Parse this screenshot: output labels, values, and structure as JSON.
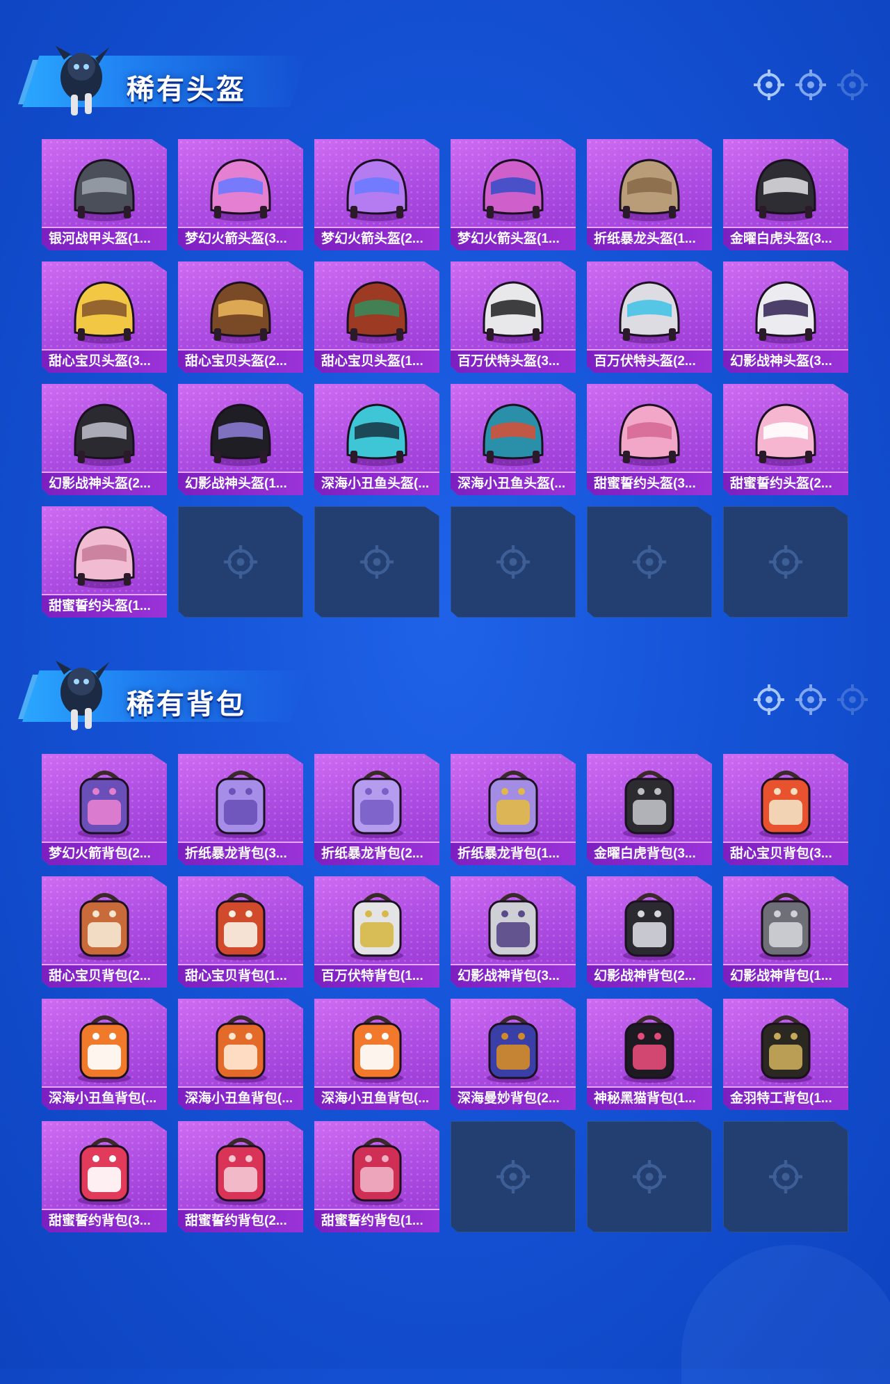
{
  "helmets": {
    "title": "稀有头盔",
    "items": [
      {
        "label": "银河战甲头盔(1...",
        "art": "helmet",
        "c1": "#4a4f5a",
        "c2": "#9aa0aa"
      },
      {
        "label": "梦幻火箭头盔(3...",
        "art": "helmet",
        "c1": "#e57fd2",
        "c2": "#6a7bff"
      },
      {
        "label": "梦幻火箭头盔(2...",
        "art": "helmet",
        "c1": "#b47cf0",
        "c2": "#6a7bff"
      },
      {
        "label": "梦幻火箭头盔(1...",
        "art": "helmet",
        "c1": "#cf5fcb",
        "c2": "#3a4fc8"
      },
      {
        "label": "折纸暴龙头盔(1...",
        "art": "helmet",
        "c1": "#b89d78",
        "c2": "#8a6b4a"
      },
      {
        "label": "金曜白虎头盔(3...",
        "art": "helmet",
        "c1": "#2d2d33",
        "c2": "#d9d9dd"
      },
      {
        "label": "甜心宝贝头盔(3...",
        "art": "helmet",
        "c1": "#f2c744",
        "c2": "#8a5a2e"
      },
      {
        "label": "甜心宝贝头盔(2...",
        "art": "helmet",
        "c1": "#7a4a26",
        "c2": "#e8b25a"
      },
      {
        "label": "甜心宝贝头盔(1...",
        "art": "helmet",
        "c1": "#9c3a24",
        "c2": "#3a8a5a"
      },
      {
        "label": "百万伏特头盔(3...",
        "art": "helmet",
        "c1": "#e8e8ea",
        "c2": "#2b2b2f"
      },
      {
        "label": "百万伏特头盔(2...",
        "art": "helmet",
        "c1": "#dcdce2",
        "c2": "#47c3e8"
      },
      {
        "label": "幻影战神头盔(3...",
        "art": "helmet",
        "c1": "#ececf0",
        "c2": "#3b2d5c"
      },
      {
        "label": "幻影战神头盔(2...",
        "art": "helmet",
        "c1": "#2a2a30",
        "c2": "#b9b9c6"
      },
      {
        "label": "幻影战神头盔(1...",
        "art": "helmet",
        "c1": "#1e1e24",
        "c2": "#8a7ad0"
      },
      {
        "label": "深海小丑鱼头盔(...",
        "art": "helmet",
        "c1": "#3ec6d6",
        "c2": "#1a3a4a"
      },
      {
        "label": "深海小丑鱼头盔(...",
        "art": "helmet",
        "c1": "#2a8fa8",
        "c2": "#d0523a"
      },
      {
        "label": "甜蜜誓约头盔(3...",
        "art": "helmet",
        "c1": "#f2a7c8",
        "c2": "#d56a96"
      },
      {
        "label": "甜蜜誓约头盔(2...",
        "art": "helmet",
        "c1": "#f6b6d0",
        "c2": "#ffffff"
      },
      {
        "label": "甜蜜誓约头盔(1...",
        "art": "helmet",
        "c1": "#f1bcd2",
        "c2": "#c77c9a"
      }
    ],
    "empty_slots": 5
  },
  "backpacks": {
    "title": "稀有背包",
    "items": [
      {
        "label": "梦幻火箭背包(2...",
        "art": "pack",
        "c1": "#6a4fb8",
        "c2": "#e47fd0"
      },
      {
        "label": "折纸暴龙背包(3...",
        "art": "pack",
        "c1": "#a58de8",
        "c2": "#6a52b8"
      },
      {
        "label": "折纸暴龙背包(2...",
        "art": "pack",
        "c1": "#b59cef",
        "c2": "#7b5fc9"
      },
      {
        "label": "折纸暴龙背包(1...",
        "art": "pack",
        "c1": "#a38ce3",
        "c2": "#e1b84a"
      },
      {
        "label": "金曜白虎背包(3...",
        "art": "pack",
        "c1": "#2b2b30",
        "c2": "#bdbdc4"
      },
      {
        "label": "甜心宝贝背包(3...",
        "art": "pack",
        "c1": "#e8522e",
        "c2": "#f2e0c0"
      },
      {
        "label": "甜心宝贝背包(2...",
        "art": "pack",
        "c1": "#c96a3a",
        "c2": "#f5e6cf"
      },
      {
        "label": "甜心宝贝背包(1...",
        "art": "pack",
        "c1": "#d24a2c",
        "c2": "#f8efe3"
      },
      {
        "label": "百万伏特背包(1...",
        "art": "pack",
        "c1": "#e4e4e6",
        "c2": "#d7b84a"
      },
      {
        "label": "幻影战神背包(3...",
        "art": "pack",
        "c1": "#cfcfd6",
        "c2": "#5a4a8a"
      },
      {
        "label": "幻影战神背包(2...",
        "art": "pack",
        "c1": "#2a2a30",
        "c2": "#d6d6de"
      },
      {
        "label": "幻影战神背包(1...",
        "art": "pack",
        "c1": "#6f6f78",
        "c2": "#d0d0d8"
      },
      {
        "label": "深海小丑鱼背包(...",
        "art": "pack",
        "c1": "#f07a2a",
        "c2": "#ffffff"
      },
      {
        "label": "深海小丑鱼背包(...",
        "art": "pack",
        "c1": "#e46a2a",
        "c2": "#ffe6d0"
      },
      {
        "label": "深海小丑鱼背包(...",
        "art": "pack",
        "c1": "#f2782c",
        "c2": "#ffffff"
      },
      {
        "label": "深海曼妙背包(2...",
        "art": "pack",
        "c1": "#3a3fa8",
        "c2": "#d08a2a"
      },
      {
        "label": "神秘黑猫背包(1...",
        "art": "pack",
        "c1": "#1e1a22",
        "c2": "#e24a7a"
      },
      {
        "label": "金羽特工背包(1...",
        "art": "pack",
        "c1": "#2a2820",
        "c2": "#c8a85a"
      },
      {
        "label": "甜蜜誓约背包(3...",
        "art": "pack",
        "c1": "#e23a5a",
        "c2": "#ffffff"
      },
      {
        "label": "甜蜜誓约背包(2...",
        "art": "pack",
        "c1": "#d93358",
        "c2": "#f4c6d2"
      },
      {
        "label": "甜蜜誓约背包(1...",
        "art": "pack",
        "c1": "#cf2f55",
        "c2": "#f0b0c4"
      }
    ],
    "empty_slots": 3
  }
}
